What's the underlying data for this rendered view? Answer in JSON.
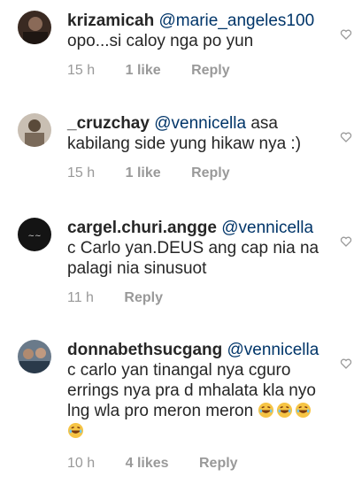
{
  "comments": [
    {
      "username": "krizamicah",
      "mention": "@marie_angeles100",
      "text": "opo...si caloy nga po yun",
      "time": "15 h",
      "likes": "1 like",
      "reply": "Reply"
    },
    {
      "username": "_cruzchay",
      "mention": "@vennicella",
      "text_line1": "asa",
      "text_line2": "kabilang side yung hikaw nya :)",
      "time": "15 h",
      "likes": "1 like",
      "reply": "Reply"
    },
    {
      "username": "cargel.churi.angge",
      "mention": "@vennicella",
      "text_line1": "c Carlo yan.DEUS ang cap nia na",
      "text_line2": "palagi nia sinusuot",
      "time": "11 h",
      "reply": "Reply"
    },
    {
      "username": "donnabethsucgang",
      "mention": "@vennicella",
      "text_line1": "c carlo yan tinangal nya cguro",
      "text_line2": "errings nya pra d mhalata kla nyo",
      "text_line3": "lng wla pro meron meron",
      "time": "10 h",
      "likes": "4 likes",
      "reply": "Reply"
    }
  ],
  "icons": {
    "emoji": "laughing-emoji",
    "heart": "heart-outline-icon"
  },
  "colors": {
    "text": "#262626",
    "mention": "#003569",
    "meta": "#999999"
  }
}
